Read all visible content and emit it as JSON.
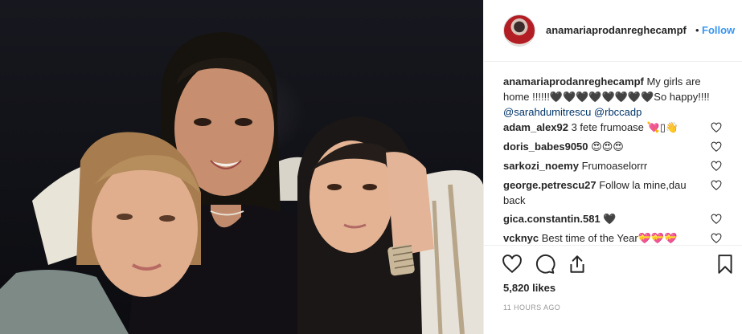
{
  "post": {
    "image_alt": "Selfie photo of three women",
    "author": {
      "username": "anamariaprodanreghecampf",
      "follow_separator": "•",
      "follow_label": "Follow"
    },
    "caption": {
      "username": "anamariaprodanreghecampf",
      "text": "My girls are home !!!!!!🖤🖤🖤🖤🖤🖤🖤🖤So happy!!!!",
      "mentions": [
        "@sarahdumitrescu",
        "@rbccadp"
      ]
    },
    "comments": [
      {
        "username": "adam_alex92",
        "text": "3 fete frumoase 💘▯👋"
      },
      {
        "username": "doris_babes9050",
        "text": "😍😍😍"
      },
      {
        "username": "sarkozi_noemy",
        "text": "Frumoaselorrr"
      },
      {
        "username": "george.petrescu27",
        "text": "Follow la mine,dau back"
      },
      {
        "username": "gica.constantin.581",
        "text": "🖤"
      },
      {
        "username": "vcknyc",
        "text": "Best time of the Year💝💝💝"
      }
    ],
    "likes": "5,820 likes",
    "timestamp": "11 HOURS AGO"
  },
  "icons": {
    "like": "heart-outline-icon",
    "comment": "speech-bubble-icon",
    "share": "share-upload-icon",
    "save": "bookmark-icon",
    "comment_like": "small-heart-icon"
  },
  "colors": {
    "link_blue": "#3897f0",
    "mention_blue": "#003569",
    "text": "#262626",
    "muted": "#999999",
    "border": "#efefef"
  }
}
